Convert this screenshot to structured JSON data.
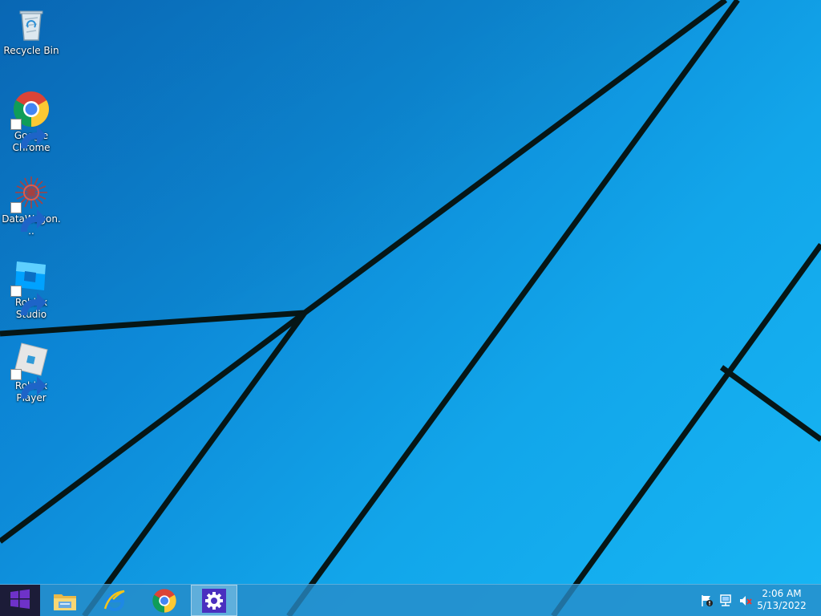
{
  "desktop": {
    "icons": [
      {
        "label": "Recycle Bin",
        "icon": "recycle-bin-icon"
      },
      {
        "label": "Google Chrome",
        "icon": "chrome-icon"
      },
      {
        "label": "DataWagon...",
        "icon": "datawagon-icon"
      },
      {
        "label": "Roblox Studio",
        "icon": "roblox-studio-icon"
      },
      {
        "label": "Roblox Player",
        "icon": "roblox-player-icon"
      }
    ]
  },
  "taskbar": {
    "start_icon": "windows-logo-icon",
    "pinned_apps": [
      {
        "icon": "file-explorer-icon"
      },
      {
        "icon": "internet-explorer-icon"
      },
      {
        "icon": "chrome-icon"
      },
      {
        "icon": "settings-gear-icon"
      }
    ],
    "tray_icons": [
      "action-center-flag-icon",
      "network-icon",
      "volume-muted-icon"
    ],
    "clock": {
      "time": "2:06 AM",
      "date": "5/13/2022"
    }
  },
  "colors": {
    "wallpaper_dark": "#0a72c8",
    "wallpaper_light": "#17b6f4",
    "line_color": "#051a1a",
    "start_bg": "#1c1c38",
    "windows_logo": "#6e32c8",
    "settings_bg": "#4a2fbf"
  }
}
